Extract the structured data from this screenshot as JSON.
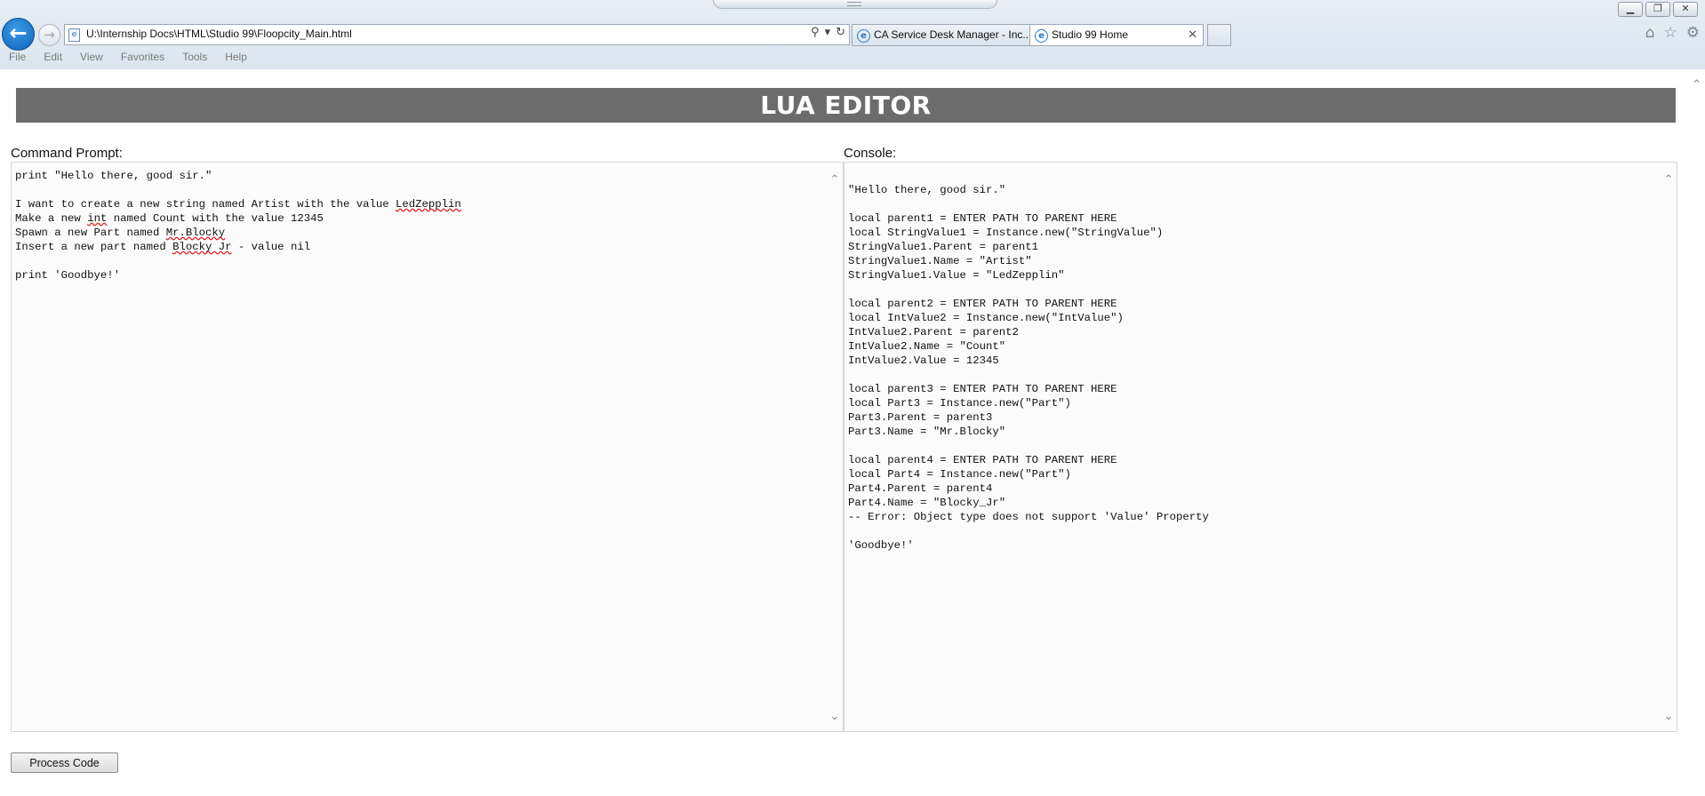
{
  "browser": {
    "address": "U:\\Internship Docs\\HTML\\Studio 99\\Floopcity_Main.html",
    "tabs": [
      {
        "label": "CA Service Desk Manager - Inc..."
      },
      {
        "label": "Studio 99 Home"
      }
    ],
    "menu": [
      "File",
      "Edit",
      "View",
      "Favorites",
      "Tools",
      "Help"
    ]
  },
  "header": {
    "title": "LUA EDITOR"
  },
  "command_prompt": {
    "label": "Command Prompt:",
    "lines": [
      "print \"Hello there, good sir.\"",
      "",
      "I want to create a new string named Artist with the value LedZepplin",
      "Make a new int named Count with the value 12345",
      "Spawn a new Part named Mr.Blocky",
      "Insert a new part named Blocky Jr - value nil",
      "",
      "print 'Goodbye!'"
    ]
  },
  "console": {
    "label": "Console:",
    "lines": [
      "",
      "\"Hello there, good sir.\"",
      "",
      "local parent1 = ENTER PATH TO PARENT HERE",
      "local StringValue1 = Instance.new(\"StringValue\")",
      "StringValue1.Parent = parent1",
      "StringValue1.Name = \"Artist\"",
      "StringValue1.Value = \"LedZepplin\"",
      "",
      "local parent2 = ENTER PATH TO PARENT HERE",
      "local IntValue2 = Instance.new(\"IntValue\")",
      "IntValue2.Parent = parent2",
      "IntValue2.Name = \"Count\"",
      "IntValue2.Value = 12345",
      "",
      "local parent3 = ENTER PATH TO PARENT HERE",
      "local Part3 = Instance.new(\"Part\")",
      "Part3.Parent = parent3",
      "Part3.Name = \"Mr.Blocky\"",
      "",
      "local parent4 = ENTER PATH TO PARENT HERE",
      "local Part4 = Instance.new(\"Part\")",
      "Part4.Parent = parent4",
      "Part4.Name = \"Blocky_Jr\"",
      "-- Error: Object type does not support 'Value' Property",
      "",
      "'Goodbye!'"
    ]
  },
  "actions": {
    "process_label": "Process Code"
  }
}
